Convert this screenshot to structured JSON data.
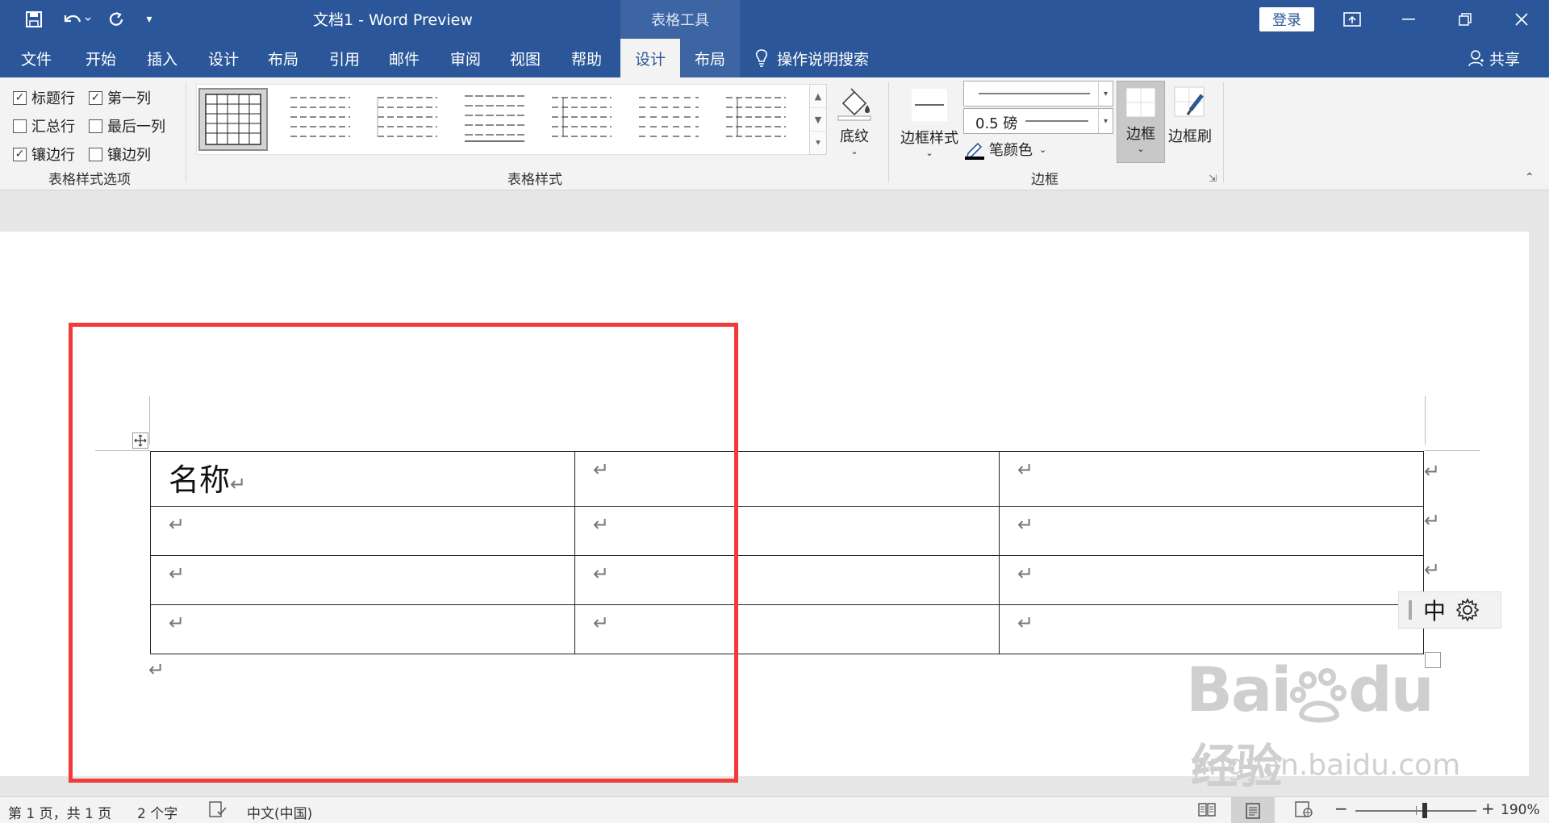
{
  "titlebar": {
    "title": "文档1  -  Word Preview",
    "context_tab": "表格工具",
    "login": "登录"
  },
  "tabs": [
    {
      "label": "文件"
    },
    {
      "label": "开始"
    },
    {
      "label": "插入"
    },
    {
      "label": "设计"
    },
    {
      "label": "布局"
    },
    {
      "label": "引用"
    },
    {
      "label": "邮件"
    },
    {
      "label": "审阅"
    },
    {
      "label": "视图"
    },
    {
      "label": "帮助"
    },
    {
      "label": "设计"
    },
    {
      "label": "布局"
    }
  ],
  "tell_me": "操作说明搜索",
  "share": "共享",
  "ribbon": {
    "style_options": {
      "label": "表格样式选项",
      "checkboxes": [
        {
          "label": "标题行",
          "checked": true
        },
        {
          "label": "第一列",
          "checked": true
        },
        {
          "label": "汇总行",
          "checked": false
        },
        {
          "label": "最后一列",
          "checked": false
        },
        {
          "label": "镶边行",
          "checked": true
        },
        {
          "label": "镶边列",
          "checked": false
        }
      ]
    },
    "table_styles": {
      "label": "表格样式",
      "shading": "底纹"
    },
    "borders": {
      "label": "边框",
      "border_styles": "边框样式",
      "weight": "0.5 磅",
      "pen_color": "笔颜色",
      "borders_button": "边框",
      "border_painter": "边框刷"
    }
  },
  "document": {
    "first_cell": "名称"
  },
  "ime": {
    "mode": "中"
  },
  "status": {
    "page": "第 1 页，共 1 页",
    "words": "2 个字",
    "language": "中文(中国)",
    "zoom": "190%"
  },
  "watermark": {
    "brand": "Bai",
    "brand_suffix": "du",
    "product": "经验",
    "url": "jingyan.baidu.com"
  },
  "colors": {
    "accent": "#2b579a",
    "highlight": "#f23a3a"
  }
}
